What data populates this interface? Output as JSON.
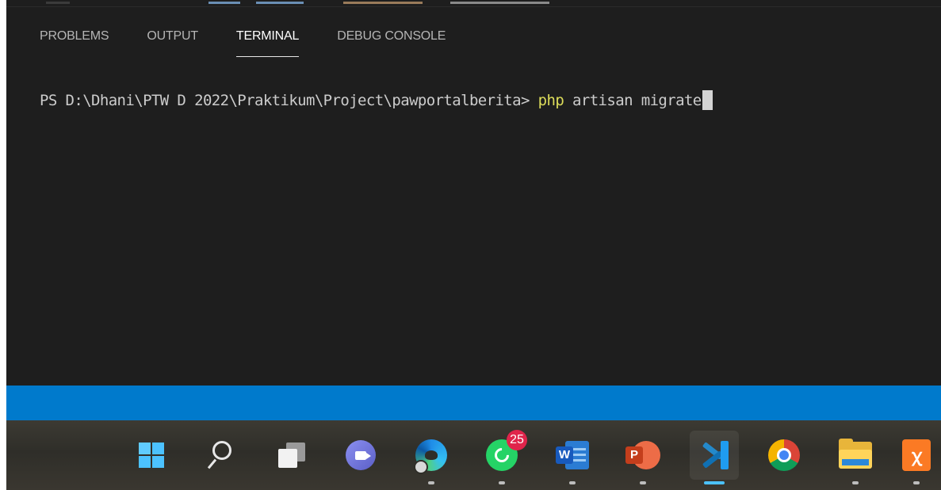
{
  "panel": {
    "tabs": [
      {
        "label": "PROBLEMS",
        "active": false
      },
      {
        "label": "OUTPUT",
        "active": false
      },
      {
        "label": "TERMINAL",
        "active": true
      },
      {
        "label": "DEBUG CONSOLE",
        "active": false
      }
    ]
  },
  "terminal": {
    "prompt": "PS D:\\Dhani\\PTW D 2022\\Praktikum\\Project\\pawportalberita> ",
    "command": "php",
    "args": " artisan migrate"
  },
  "colors": {
    "terminal_bg": "#1e1e1e",
    "command_highlight": "#dcdc5a",
    "statusbar": "#007acc",
    "active_indicator": "#4cc2ff"
  },
  "taskbar": {
    "items": [
      {
        "icon": "windows-start-icon"
      },
      {
        "icon": "search-icon"
      },
      {
        "icon": "task-view-icon"
      },
      {
        "icon": "teams-chat-icon"
      },
      {
        "icon": "edge-icon"
      },
      {
        "icon": "whatsapp-icon",
        "badge": "25"
      },
      {
        "icon": "word-icon",
        "letter": "W"
      },
      {
        "icon": "powerpoint-icon",
        "letter": "P"
      },
      {
        "icon": "vscode-icon",
        "active": true
      },
      {
        "icon": "chrome-icon"
      },
      {
        "icon": "file-explorer-icon"
      },
      {
        "icon": "xampp-icon",
        "glyph": "ꭓ"
      }
    ]
  }
}
